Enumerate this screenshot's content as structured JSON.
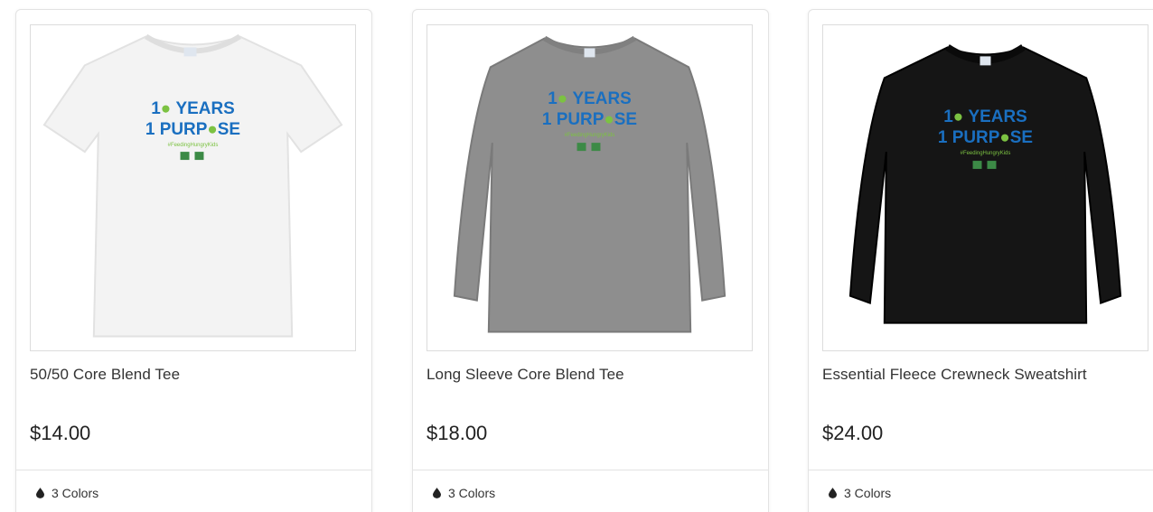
{
  "products": [
    {
      "title": "50/50 Core Blend Tee",
      "price": "$14.00",
      "colors": "3 Colors",
      "garment_color": "#f4f4f4",
      "garment_type": "short-sleeve-tee"
    },
    {
      "title": "Long Sleeve Core Blend Tee",
      "price": "$18.00",
      "colors": "3 Colors",
      "garment_color": "#8f8f8f",
      "garment_type": "long-sleeve-tee"
    },
    {
      "title": "Essential Fleece Crewneck Sweatshirt",
      "price": "$24.00",
      "colors": "3 Colors",
      "garment_color": "#151515",
      "garment_type": "crewneck-sweatshirt"
    }
  ],
  "print": {
    "line1": "1",
    "line1b": "YEARS",
    "line2a": "1 PURP",
    "line2b": "SE",
    "hashtag": "#FeedingHungryKids",
    "blue": "#1a6fc0",
    "green": "#7cc242"
  },
  "icons": {
    "colors": "drop-icon"
  }
}
